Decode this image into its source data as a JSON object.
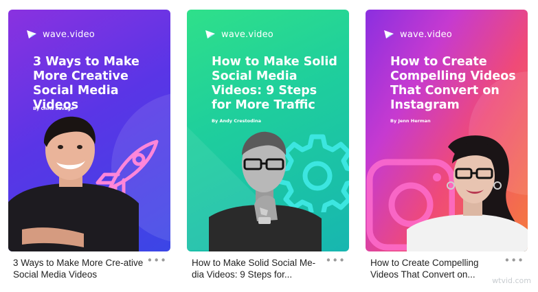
{
  "cards": [
    {
      "brand": "wave.video",
      "cover_title": "3 Ways to Make More Creative Social Media Videos",
      "byline": "By Chris Savage",
      "caption": "3 Ways to Make More Cre-ative Social Media Videos",
      "more": "•••",
      "colors": {
        "start": "#8a32e0",
        "end": "#3b46e6"
      },
      "icon": "rocket-icon"
    },
    {
      "brand": "wave.video",
      "cover_title": "How to Make Solid Social Media Videos: 9 Steps for More Traffic",
      "byline": "By Andy Crestodina",
      "caption": "How to Make Solid Social Me-dia Videos: 9 Steps for...",
      "more": "•••",
      "colors": {
        "start": "#2fe08a",
        "end": "#17b6b0"
      },
      "icon": "gear-icon"
    },
    {
      "brand": "wave.video",
      "cover_title": "How to Create Compelling Videos That Convert on Instagram",
      "byline": "By Jenn Herman",
      "caption": "How to Create Compelling Videos That Convert on...",
      "more": "•••",
      "colors": {
        "start": "#8b2fe0",
        "end": "#f57c3a"
      },
      "icon": "instagram-icon"
    }
  ],
  "watermark": "wtvid.com"
}
